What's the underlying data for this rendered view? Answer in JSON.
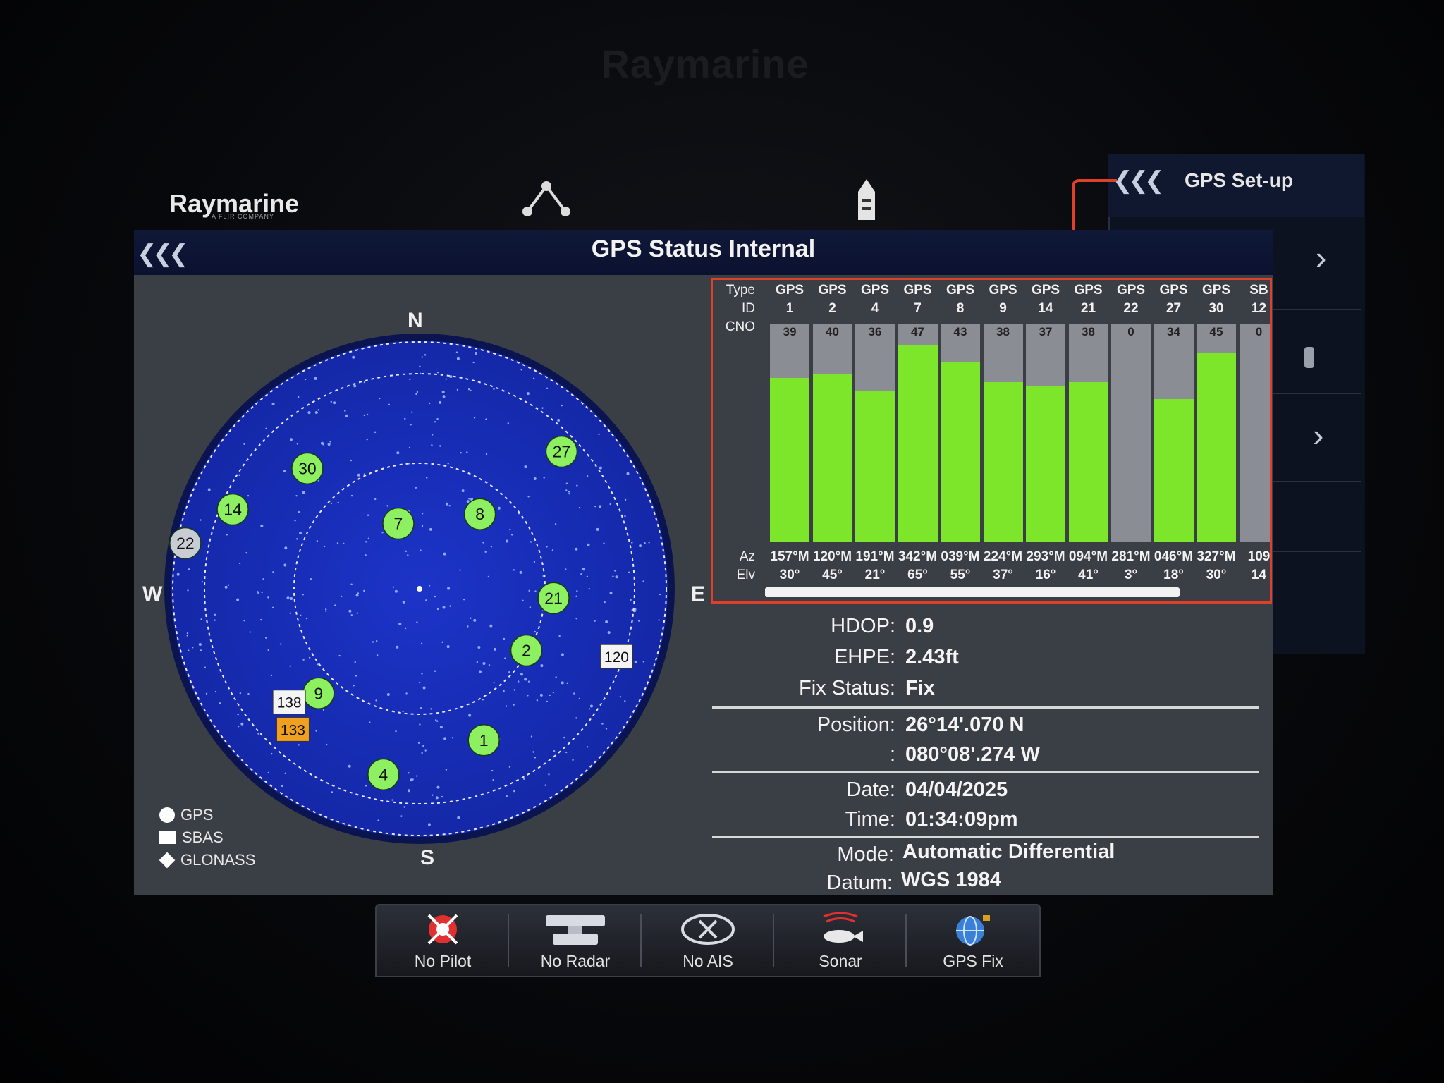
{
  "bezel": {
    "brand": "Raymarine"
  },
  "topbar": {
    "brand": "Raymarine",
    "brand_sub": "A FLIR COMPANY"
  },
  "setup_panel": {
    "title": "GPS Set-up"
  },
  "window": {
    "title": "GPS Status Internal"
  },
  "compass": {
    "n": "N",
    "s": "S",
    "e": "E",
    "w": "W"
  },
  "legend": {
    "gps": "GPS",
    "sbas": "SBAS",
    "glonass": "GLONASS"
  },
  "skyplot": {
    "satellites": [
      {
        "id": "30",
        "type": "gps",
        "az": 317,
        "elv": 30,
        "used": true
      },
      {
        "id": "27",
        "type": "gps",
        "az": 46,
        "elv": 18,
        "used": true
      },
      {
        "id": "8",
        "type": "gps",
        "az": 39,
        "elv": 55,
        "used": true
      },
      {
        "id": "7",
        "type": "gps",
        "az": 342,
        "elv": 65,
        "used": true
      },
      {
        "id": "14",
        "type": "gps",
        "az": 293,
        "elv": 16,
        "used": true
      },
      {
        "id": "22",
        "type": "gps",
        "az": 281,
        "elv": 3,
        "used": false
      },
      {
        "id": "21",
        "type": "gps",
        "az": 94,
        "elv": 41,
        "used": true
      },
      {
        "id": "2",
        "type": "gps",
        "az": 120,
        "elv": 45,
        "used": true
      },
      {
        "id": "9",
        "type": "gps",
        "az": 224,
        "elv": 37,
        "used": true
      },
      {
        "id": "1",
        "type": "gps",
        "az": 157,
        "elv": 30,
        "used": true
      },
      {
        "id": "4",
        "type": "gps",
        "az": 191,
        "elv": 21,
        "used": true
      },
      {
        "id": "120",
        "type": "sbas",
        "az": 109,
        "elv": 14,
        "used": false
      },
      {
        "id": "138",
        "type": "sbas",
        "az": 229,
        "elv": 27,
        "used": false
      },
      {
        "id": "133",
        "type": "sbas",
        "az": 222,
        "elv": 21,
        "used": true
      }
    ]
  },
  "signal_table": {
    "row_labels": {
      "type": "Type",
      "id": "ID",
      "cno": "CNO",
      "az": "Az",
      "elv": "Elv"
    },
    "columns": [
      {
        "type": "GPS",
        "id": "1",
        "cno": "39",
        "cno_value": 39,
        "az": "157°M",
        "elv": "30°"
      },
      {
        "type": "GPS",
        "id": "2",
        "cno": "40",
        "cno_value": 40,
        "az": "120°M",
        "elv": "45°"
      },
      {
        "type": "GPS",
        "id": "4",
        "cno": "36",
        "cno_value": 36,
        "az": "191°M",
        "elv": "21°"
      },
      {
        "type": "GPS",
        "id": "7",
        "cno": "47",
        "cno_value": 47,
        "az": "342°M",
        "elv": "65°"
      },
      {
        "type": "GPS",
        "id": "8",
        "cno": "43",
        "cno_value": 43,
        "az": "039°M",
        "elv": "55°"
      },
      {
        "type": "GPS",
        "id": "9",
        "cno": "38",
        "cno_value": 38,
        "az": "224°M",
        "elv": "37°"
      },
      {
        "type": "GPS",
        "id": "14",
        "cno": "37",
        "cno_value": 37,
        "az": "293°M",
        "elv": "16°"
      },
      {
        "type": "GPS",
        "id": "21",
        "cno": "38",
        "cno_value": 38,
        "az": "094°M",
        "elv": "41°"
      },
      {
        "type": "GPS",
        "id": "22",
        "cno": "0",
        "cno_value": 0,
        "az": "281°M",
        "elv": "3°"
      },
      {
        "type": "GPS",
        "id": "27",
        "cno": "34",
        "cno_value": 34,
        "az": "046°M",
        "elv": "18°"
      },
      {
        "type": "GPS",
        "id": "30",
        "cno": "45",
        "cno_value": 45,
        "az": "327°M",
        "elv": "30°"
      },
      {
        "type": "SB",
        "id": "12",
        "cno": "0",
        "cno_value": 0,
        "az": "109",
        "elv": "14"
      }
    ],
    "cno_max": 52
  },
  "info": {
    "hdop_label": "HDOP:",
    "hdop": "0.9",
    "ehpe_label": "EHPE:",
    "ehpe": "2.43ft",
    "fix_label": "Fix Status:",
    "fix": "Fix",
    "position_label": "Position:",
    "lat": "26°14'.070 N",
    "lon_label": ":",
    "lon": "080°08'.274 W",
    "date_label": "Date:",
    "date": "04/04/2025",
    "time_label": "Time:",
    "time": "01:34:09pm",
    "mode_label": "Mode:",
    "mode": "Automatic Differential",
    "datum_label": "Datum:",
    "datum": "WGS 1984"
  },
  "dock": {
    "items": [
      {
        "label": "No Pilot"
      },
      {
        "label": "No Radar"
      },
      {
        "label": "No AIS"
      },
      {
        "label": "Sonar"
      },
      {
        "label": "GPS Fix"
      }
    ]
  },
  "colors": {
    "sky": "#1a2fc0",
    "fill": "#7ee62a",
    "accent": "#e0402a",
    "panel": "#3a3e45"
  }
}
